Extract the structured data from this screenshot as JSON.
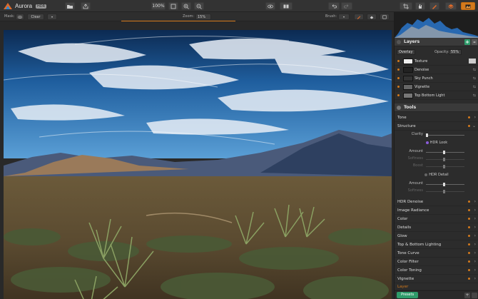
{
  "app": {
    "name": "Aurora",
    "badge": "HDR"
  },
  "toolbar": {
    "zoom_value": "100%"
  },
  "subbar": {
    "mask_label": "Mask:",
    "clear_label": "Clear",
    "zoom_label": "Zoom:",
    "zoom_value": "15%",
    "brush_label": "Brush:"
  },
  "layers": {
    "title": "Layers",
    "blend_mode": "Overlay",
    "opacity_label": "Opacity:",
    "opacity_value": "55%",
    "items": [
      {
        "name": "Texture"
      },
      {
        "name": "Denoise"
      },
      {
        "name": "Sky Punch"
      },
      {
        "name": "Vignette"
      },
      {
        "name": "Top Bottom Light"
      }
    ]
  },
  "tools": {
    "title": "Tools",
    "tone": "Tone",
    "structure": "Structure",
    "clarity_label": "Clarity",
    "hdr_look": "HDR Look",
    "amount_label": "Amount",
    "softness_label": "Softness",
    "boost_label": "Boost",
    "hdr_detail": "HDR Detail",
    "amount2_label": "Amount",
    "softness2_label": "Softness",
    "items": [
      "HDR Denoise",
      "Image Radiance",
      "Color",
      "Details",
      "Glow",
      "Top & Bottom Lighting",
      "Tone Curve",
      "Color Filter",
      "Color Toning",
      "Vignette"
    ],
    "layer_label": "Layer"
  },
  "bottom": {
    "presets_label": "Presets"
  },
  "colors": {
    "accent": "#d47a1c",
    "green": "#2e9b6a"
  }
}
